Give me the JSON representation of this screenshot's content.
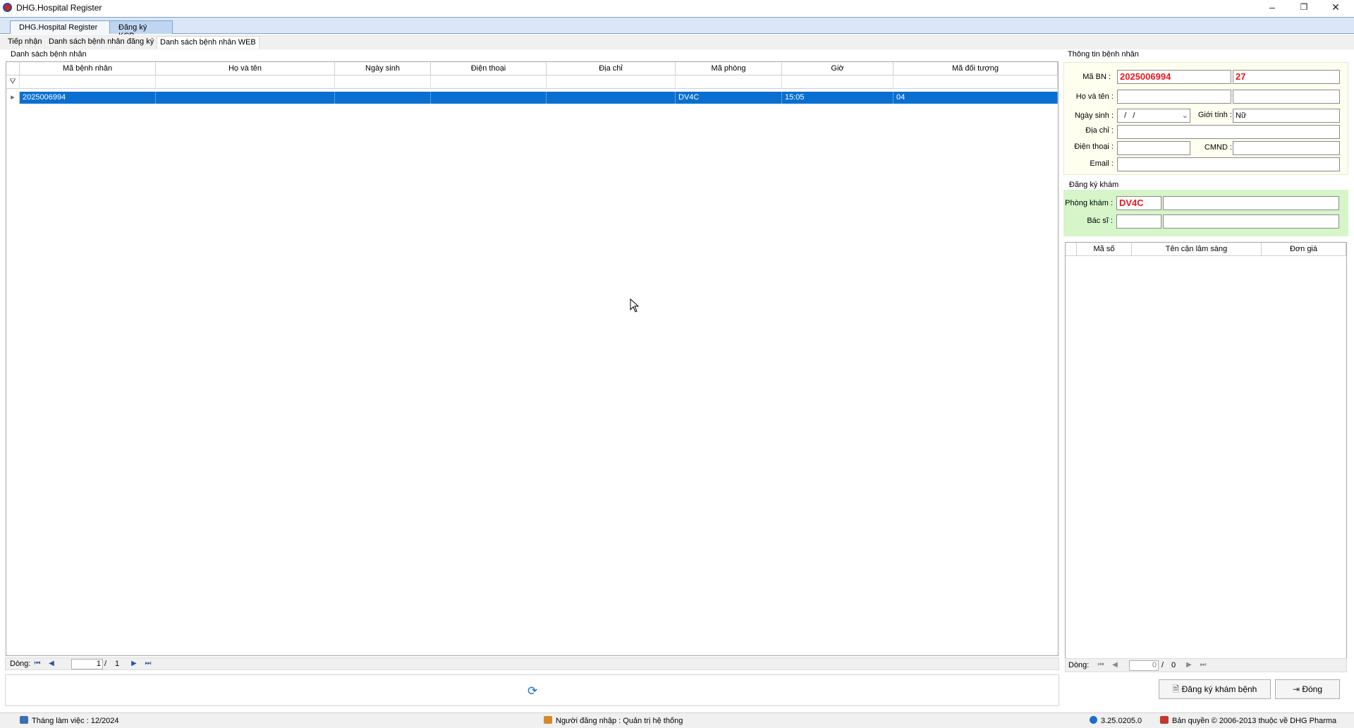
{
  "window": {
    "title": "DHG.Hospital Register",
    "minimize": "–",
    "maximize": "❐",
    "close": "✕"
  },
  "doc_tabs": [
    "DHG.Hospital Register",
    "Đăng ký KCB"
  ],
  "sub_tabs": [
    "Tiếp nhận",
    "Danh sách bệnh nhân đăng ký",
    "Danh sách bệnh nhân WEB"
  ],
  "left": {
    "panel_title": "Danh sách bệnh nhân",
    "columns": [
      "Mã bệnh nhân",
      "Họ và tên",
      "Ngày sinh",
      "Điện thoại",
      "Địa chỉ",
      "Mã phòng",
      "Giờ",
      "Mã đối tượng"
    ],
    "rows": [
      [
        "2025006994",
        "",
        "",
        "",
        "",
        "DV4C",
        "15:05",
        "04"
      ]
    ],
    "footer": {
      "label": "Dòng:",
      "page": "1",
      "sep": "/",
      "total": "1"
    }
  },
  "right": {
    "info_title": "Thông tin bệnh nhân",
    "ma_bn_label": "Mã BN :",
    "ma_bn_value": "2025006994",
    "age_value": "27",
    "ho_ten_label": "Họ và tên :",
    "ngay_sinh_label": "Ngày sinh :",
    "ngay_sinh_value": "  /   /",
    "gioi_tinh_label": "Giới tính :",
    "gioi_tinh_value": "Nữ",
    "dia_chi_label": "Địa chỉ :",
    "dien_thoai_label": "Điện thoại :",
    "cmnd_label": "CMND :",
    "email_label": "Email :",
    "reg_title": "Đăng ký khám",
    "phong_kham_label": "Phòng khám :",
    "phong_kham_value": "DV4C",
    "bac_si_label": "Bác sĩ :",
    "columns": [
      "Mã số",
      "Tên cận lâm sàng",
      "Đơn giá"
    ],
    "footer": {
      "label": "Dòng:",
      "page": "0",
      "sep": "/",
      "total": "0"
    },
    "register_button": "Đăng ký khám bệnh",
    "close_button": "Đóng"
  },
  "status": {
    "month": "Tháng làm việc : 12/2024",
    "user": "Người đăng nhập : Quản trị hệ thống",
    "version": "3.25.0205.0",
    "copyright": "Bản quyền © 2006-2013 thuộc về DHG Pharma"
  }
}
